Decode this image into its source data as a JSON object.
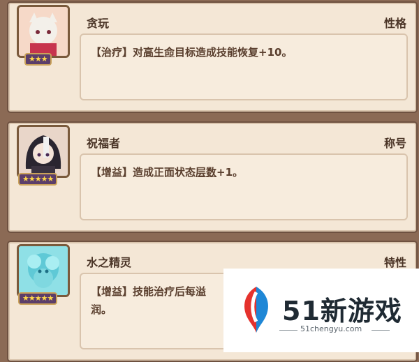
{
  "cards": [
    {
      "name": "贪玩",
      "tag": "性格",
      "stars": "★★★",
      "desc_prefix": "【治疗】对",
      "desc_underline": "高生命",
      "desc_suffix": "目标造成技能恢复+10。"
    },
    {
      "name": "祝福者",
      "tag": "称号",
      "stars": "★★★★★",
      "desc_prefix": "【增益】造成正面状态",
      "desc_underline": "层数",
      "desc_suffix": "+1。"
    },
    {
      "name": "水之精灵",
      "tag": "特性",
      "stars": "★★★★★",
      "desc_line1": "【增益】技能治疗后每溢",
      "desc_line2": "润。"
    }
  ],
  "watermark": {
    "brand": "51新游戏",
    "url": "51chengyu.com"
  },
  "colors": {
    "frame": "#8b6a55",
    "card": "#f4e7d6",
    "text": "#4a3426"
  }
}
